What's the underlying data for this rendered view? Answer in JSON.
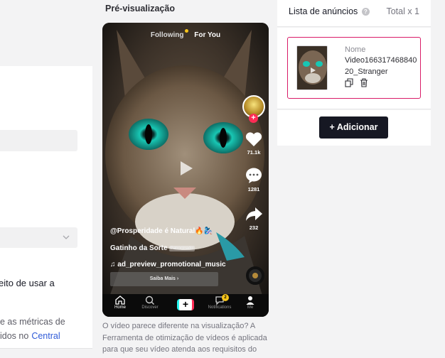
{
  "left_panel": {
    "text_line1": "eito de usar a",
    "text_line2": "e as métricas de",
    "text_line3": "idos no",
    "text_link": "Central"
  },
  "preview": {
    "title": "Pré-visualização",
    "feed_tabs": {
      "following": "Following",
      "for_you": "For You"
    },
    "counts": {
      "likes": "71.1k",
      "comments": "1281",
      "shares": "232"
    },
    "caption_user": "@Prosperidade é Natural🔥🧞‍♀️",
    "caption_text": "Gatinho da Sorte",
    "caption_badge": "Patrocinado",
    "music": "♫ ad_preview_promotional_music",
    "cta": "Saiba Mais",
    "nav": {
      "home": "Home",
      "discover": "Discover",
      "notifications": "Notifications",
      "me": "Me",
      "inbox_count": "2"
    },
    "note": "O vídeo parece diferente na visualização? A Ferramenta de otimização de vídeos é aplicada para que seu vídeo atenda aos requisitos do"
  },
  "ad_list": {
    "title": "Lista de anúncios",
    "total": "Total x 1",
    "item": {
      "label": "Nome",
      "name": "Video16631746884020_Stranger"
    },
    "add_button": "+ Adicionar"
  },
  "colors": {
    "accent_pink": "#d91b68",
    "dark_button": "#161823",
    "link": "#2f5bd8"
  }
}
